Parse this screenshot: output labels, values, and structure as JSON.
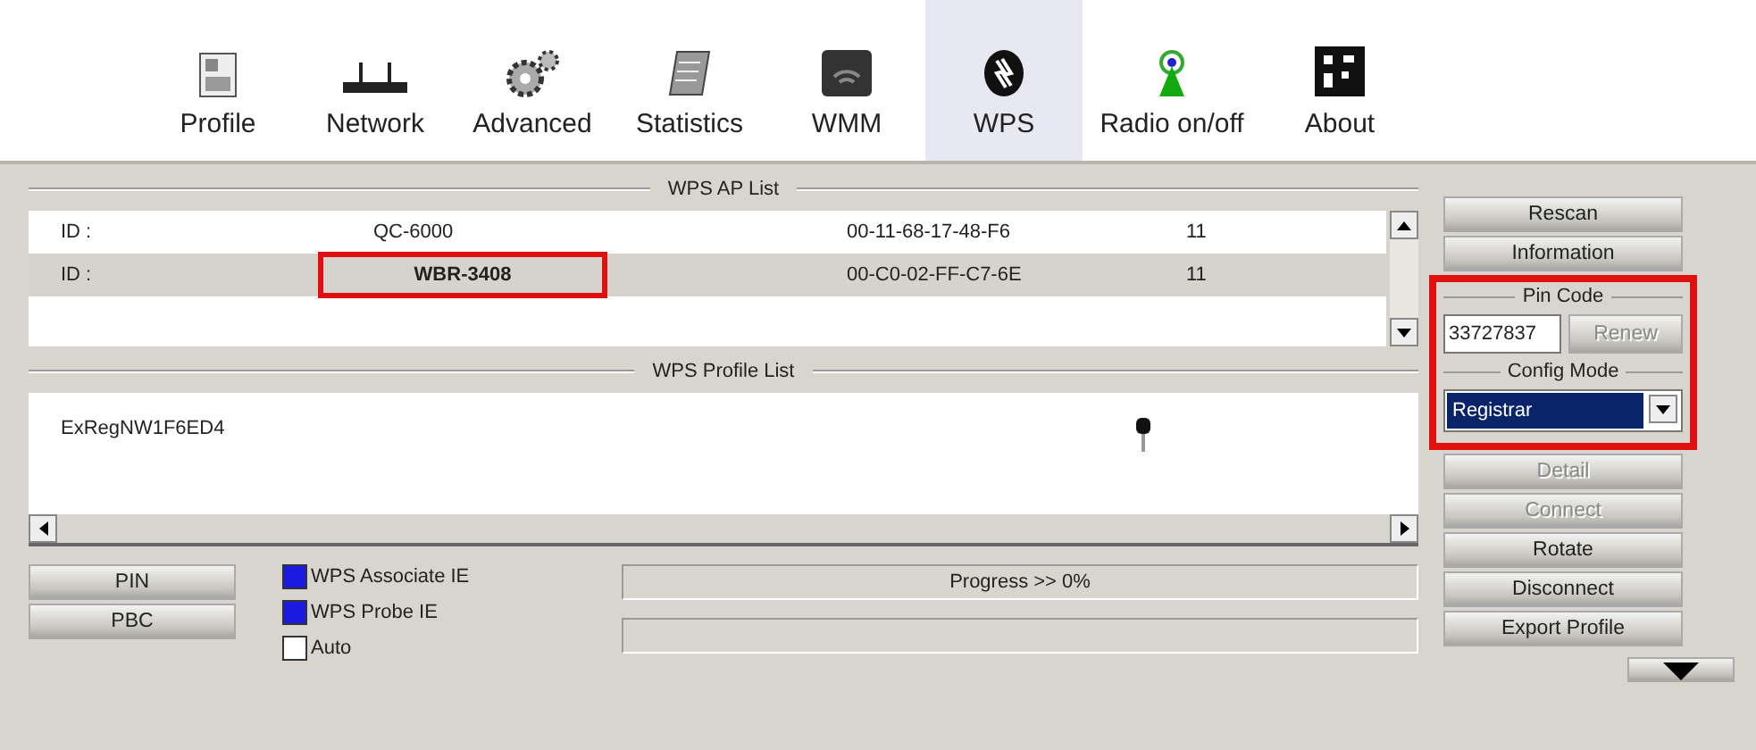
{
  "toolbar": {
    "tabs": [
      {
        "label": "Profile",
        "selected": false
      },
      {
        "label": "Network",
        "selected": false
      },
      {
        "label": "Advanced",
        "selected": false
      },
      {
        "label": "Statistics",
        "selected": false
      },
      {
        "label": "WMM",
        "selected": false
      },
      {
        "label": "WPS",
        "selected": true
      },
      {
        "label": "Radio on/off",
        "selected": false
      },
      {
        "label": "About",
        "selected": false
      }
    ]
  },
  "ap_list": {
    "title": "WPS AP List",
    "rows": [
      {
        "label": "ID :",
        "ssid": "QC-6000",
        "bssid": "00-11-68-17-48-F6",
        "channel": "11",
        "selected": false,
        "highlighted": false
      },
      {
        "label": "ID :",
        "ssid": "WBR-3408",
        "bssid": "00-C0-02-FF-C7-6E",
        "channel": "11",
        "selected": true,
        "highlighted": true
      }
    ]
  },
  "profile_list": {
    "title": "WPS Profile List",
    "rows": [
      {
        "name": "ExRegNW1F6ED4"
      }
    ]
  },
  "options": {
    "buttons": [
      {
        "label": "PIN"
      },
      {
        "label": "PBC"
      }
    ],
    "checkboxes": [
      {
        "label": "WPS Associate IE",
        "checked": true
      },
      {
        "label": "WPS Probe IE",
        "checked": true
      },
      {
        "label": "Auto",
        "checked": false
      }
    ],
    "progress": [
      {
        "text": "Progress >> 0%",
        "level": 0
      },
      {
        "level": 0
      }
    ]
  },
  "side": {
    "top_buttons": [
      {
        "label": "Rescan",
        "disabled": false
      },
      {
        "label": "Information",
        "disabled": false
      }
    ],
    "wps_settings": {
      "highlighted": true,
      "pin_code_title": "Pin Code",
      "pin_code": "33727837",
      "renew_button": {
        "label": "Renew",
        "disabled": true
      },
      "config_mode_title": "Config Mode",
      "config_mode": "Registrar"
    },
    "bottom_buttons": [
      {
        "label": "Detail",
        "disabled": true
      },
      {
        "label": "Connect",
        "disabled": true
      },
      {
        "label": "Rotate",
        "disabled": false
      },
      {
        "label": "Disconnect",
        "disabled": false
      },
      {
        "label": "Export Profile",
        "disabled": false
      }
    ]
  }
}
